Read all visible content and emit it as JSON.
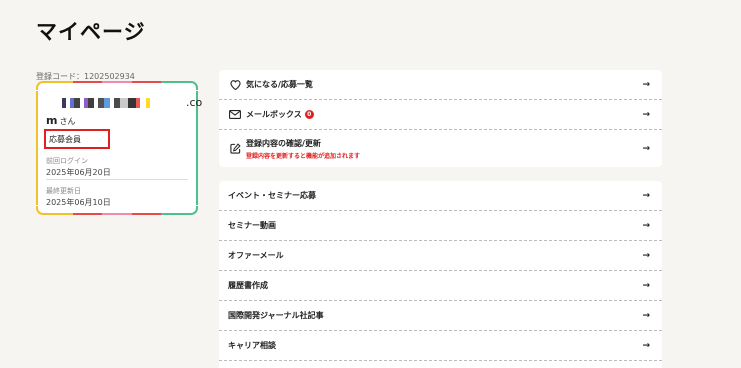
{
  "page": {
    "title": "マイページ"
  },
  "profile": {
    "registration_code": "登録コード：1202502934",
    "email_suffix": ".co",
    "email_line2": "m",
    "honorific": "さん",
    "member_type": "応募会員",
    "last_login_label": "前回ログイン",
    "last_login_value": "2025年06月20日",
    "last_updated_label": "最終更新日",
    "last_updated_value": "2025年06月10日"
  },
  "menu_group_1": [
    {
      "label": "気になる/応募一覧",
      "icon": "heart-icon"
    },
    {
      "label": "メールボックス",
      "icon": "mail-icon",
      "badge": "0"
    },
    {
      "label": "登録内容の確認/更新",
      "icon": "edit-icon",
      "sublabel": "登録内容を更新すると機能が追加されます"
    }
  ],
  "menu_group_2": [
    {
      "label": "イベント・セミナー応募"
    },
    {
      "label": "セミナー動画"
    },
    {
      "label": "オファーメール"
    },
    {
      "label": "履歴書作成"
    },
    {
      "label": "国際開発ジャーナル社記事"
    },
    {
      "label": "キャリア相談"
    }
  ],
  "arrow_glyph": "→",
  "colors": {
    "accent_red": "#e02020",
    "stripe_yellow": "#f0c12c",
    "stripe_green": "#4fc08d",
    "stripe_red": "#e84a4a",
    "stripe_pink": "#f08bb0"
  }
}
